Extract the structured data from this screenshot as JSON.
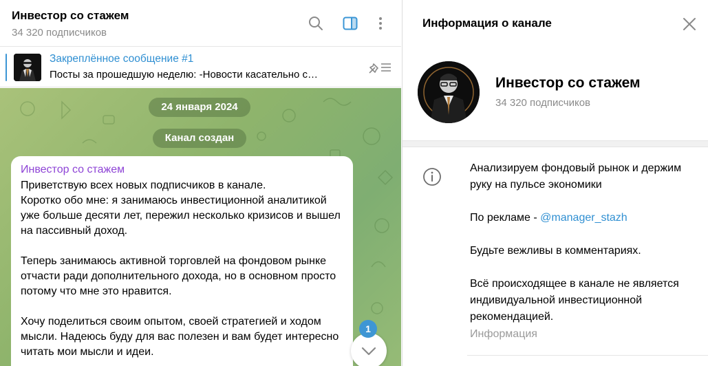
{
  "chat": {
    "title": "Инвестор со стажем",
    "subscribers": "34 320 подписчиков",
    "icons": [
      "search-icon",
      "sidebar-toggle-icon",
      "more-vertical-icon"
    ]
  },
  "pinned": {
    "title": "Закреплённое сообщение #1",
    "text": "Посты за прошедшую неделю:  -Новости касательно с…",
    "icon": "pin-list-icon"
  },
  "messages": {
    "date_pill": "24 января 2024",
    "service_pill": "Канал создан",
    "bubble": {
      "author": "Инвестор со стажем",
      "text": "Приветствую всех новых подписчиков в канале.\nКоротко обо мне: я занимаюсь инвестиционной аналитикой уже больше десяти лет, пережил несколько кризисов и вышел на пассивный доход.\n\nТеперь занимаюсь активной торговлей на фондовом рынке отчасти ради дополнительного дохода, но в основном просто потому что мне это нравится.\n\nХочу поделиться своим опытом, своей стратегией и ходом мысли. Надеюсь буду для вас полезен и вам будет интересно читать мои мысли и идеи."
    },
    "unread_count": "1"
  },
  "info_panel": {
    "title": "Информация о канале",
    "channel_name": "Инвестор со стажем",
    "subscribers": "34 320 подписчиков",
    "description_line1": "Анализируем фондовый рынок и держим руку на пульсе экономики",
    "ads_prefix": "По рекламе - ",
    "ads_link": "@manager_stazh",
    "rules": "Будьте вежливы в комментариях.",
    "disclaimer": "Всё происходящее в канале не является индивидуальной инвестиционной рекомендацией.",
    "caption": "Информация"
  },
  "colors": {
    "accent": "#2f8fd2",
    "author": "#8e44d6",
    "badge": "#3e96d4",
    "chat_bg": "#8fb46c"
  }
}
